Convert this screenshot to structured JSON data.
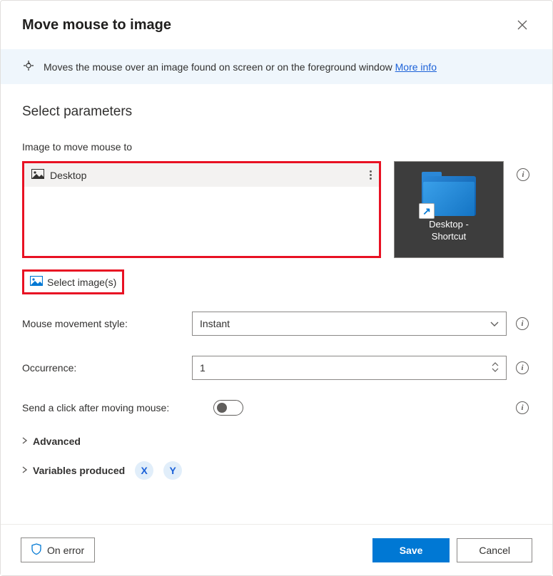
{
  "header": {
    "title": "Move mouse to image"
  },
  "banner": {
    "text": "Moves the mouse over an image found on screen or on the foreground window ",
    "link": "More info"
  },
  "section": {
    "title": "Select parameters",
    "image_label": "Image to move mouse to",
    "image_item": "Desktop",
    "preview_caption_line1": "Desktop -",
    "preview_caption_line2": "Shortcut",
    "select_images": "Select image(s)"
  },
  "params": {
    "mouse_style_label": "Mouse movement style:",
    "mouse_style_value": "Instant",
    "occurrence_label": "Occurrence:",
    "occurrence_value": "1",
    "send_click_label": "Send a click after moving mouse:",
    "advanced": "Advanced",
    "variables_produced": "Variables produced",
    "var_x": "X",
    "var_y": "Y"
  },
  "footer": {
    "on_error": "On error",
    "save": "Save",
    "cancel": "Cancel"
  }
}
